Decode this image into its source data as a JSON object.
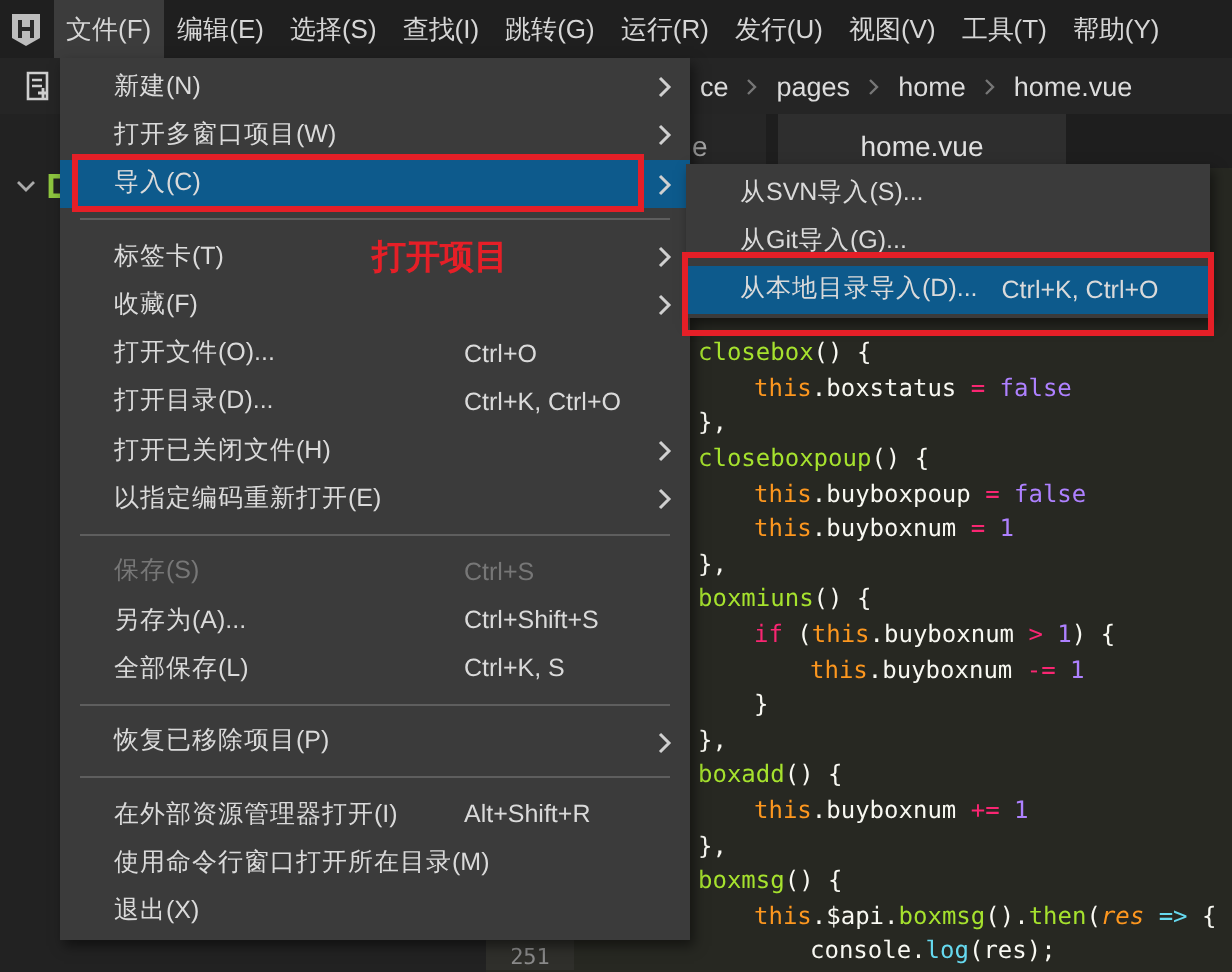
{
  "menubar": [
    {
      "label": "文件(F)",
      "selected": true
    },
    {
      "label": "编辑(E)",
      "selected": false
    },
    {
      "label": "选择(S)",
      "selected": false
    },
    {
      "label": "查找(I)",
      "selected": false
    },
    {
      "label": "跳转(G)",
      "selected": false
    },
    {
      "label": "运行(R)",
      "selected": false
    },
    {
      "label": "发行(U)",
      "selected": false
    },
    {
      "label": "视图(V)",
      "selected": false
    },
    {
      "label": "工具(T)",
      "selected": false
    },
    {
      "label": "帮助(Y)",
      "selected": false
    }
  ],
  "breadcrumb": [
    "ce",
    "pages",
    "home",
    "home.vue"
  ],
  "tabs": [
    {
      "label": "e",
      "selected": false
    },
    {
      "label": "home.vue",
      "selected": true
    }
  ],
  "code_lines": [
    {
      "tokens": [
        {
          "kind": "fn",
          "text": "closebox"
        },
        {
          "kind": "punct",
          "text": "() {"
        }
      ],
      "children": [
        {
          "tokens": [
            {
              "kind": "this",
              "text": "this"
            },
            {
              "kind": "punct",
              "text": ".boxstatus"
            },
            {
              "kind": "op",
              "text": "="
            },
            {
              "kind": "literal",
              "text": "false"
            }
          ]
        }
      ]
    },
    {
      "tokens": [
        {
          "kind": "punct",
          "text": "},"
        }
      ]
    },
    {
      "tokens": [
        {
          "kind": "fn",
          "text": "closeboxpoup"
        },
        {
          "kind": "punct",
          "text": "() {"
        }
      ],
      "children": [
        {
          "tokens": [
            {
              "kind": "this",
              "text": "this"
            },
            {
              "kind": "punct",
              "text": ".buyboxpoup"
            },
            {
              "kind": "op",
              "text": "="
            },
            {
              "kind": "literal",
              "text": "false"
            }
          ]
        },
        {
          "tokens": [
            {
              "kind": "this",
              "text": "this"
            },
            {
              "kind": "punct",
              "text": ".buyboxnum"
            },
            {
              "kind": "op",
              "text": "="
            },
            {
              "kind": "literal",
              "text": "1"
            }
          ]
        }
      ]
    },
    {
      "tokens": [
        {
          "kind": "punct",
          "text": "},"
        }
      ]
    },
    {
      "tokens": [
        {
          "kind": "fn",
          "text": "boxmiuns"
        },
        {
          "kind": "punct",
          "text": "() {"
        }
      ],
      "children": [
        {
          "tokens": [
            {
              "kind": "keyword",
              "text": "if"
            },
            {
              "kind": "punct",
              "text": "("
            },
            {
              "kind": "this",
              "text": "this"
            },
            {
              "kind": "punct",
              "text": ".buyboxnum"
            },
            {
              "kind": "op",
              "text": ">"
            },
            {
              "kind": "literal",
              "text": "1"
            },
            {
              "kind": "punct",
              "text": ") {"
            }
          ],
          "children": [
            {
              "tokens": [
                {
                  "kind": "this",
                  "text": "this"
                },
                {
                  "kind": "punct",
                  "text": ".buyboxnum"
                },
                {
                  "kind": "op",
                  "text": "-="
                },
                {
                  "kind": "literal",
                  "text": "1"
                }
              ]
            }
          ]
        },
        {
          "tokens": [
            {
              "kind": "punct",
              "text": "}"
            }
          ]
        }
      ]
    },
    {
      "tokens": [
        {
          "kind": "punct",
          "text": "},"
        }
      ]
    },
    {
      "tokens": [
        {
          "kind": "fn",
          "text": "boxadd"
        },
        {
          "kind": "punct",
          "text": "() {"
        }
      ],
      "children": [
        {
          "tokens": [
            {
              "kind": "this",
              "text": "this"
            },
            {
              "kind": "punct",
              "text": ".buyboxnum"
            },
            {
              "kind": "op",
              "text": "+="
            },
            {
              "kind": "literal",
              "text": "1"
            }
          ]
        }
      ]
    },
    {
      "tokens": [
        {
          "kind": "punct",
          "text": "},"
        }
      ]
    },
    {
      "tokens": [
        {
          "kind": "fn",
          "text": "boxmsg"
        },
        {
          "kind": "punct",
          "text": "() {"
        }
      ],
      "children": [
        {
          "tokens": [
            {
              "kind": "this",
              "text": "this"
            },
            {
              "kind": "punct",
              "text": ".$api."
            },
            {
              "kind": "fn",
              "text": "boxmsg"
            },
            {
              "kind": "punct",
              "text": "()."
            },
            {
              "kind": "fn",
              "text": "then"
            },
            {
              "kind": "punct",
              "text": "("
            },
            {
              "kind": "param",
              "text": "res"
            },
            {
              "kind": "arrow",
              "text": "=>"
            },
            {
              "kind": "punct",
              "text": "{"
            }
          ],
          "children": [
            {
              "line_number": "251",
              "tokens": [
                {
                  "kind": "punct",
                  "text": "console."
                },
                {
                  "kind": "builtin",
                  "text": "log"
                },
                {
                  "kind": "punct",
                  "text": "(res);"
                }
              ]
            }
          ]
        }
      ]
    }
  ],
  "file_menu": [
    {
      "kind": "item",
      "label": "新建(N)",
      "submenu": true,
      "selected": false,
      "disabled": false
    },
    {
      "kind": "item",
      "label": "打开多窗口项目(W)",
      "submenu": true,
      "selected": false,
      "disabled": false
    },
    {
      "kind": "item",
      "label": "导入(C)",
      "submenu": true,
      "selected": true,
      "disabled": false
    },
    {
      "kind": "separator"
    },
    {
      "kind": "item",
      "label": "标签卡(T)",
      "submenu": true,
      "selected": false,
      "disabled": false
    },
    {
      "kind": "item",
      "label": "收藏(F)",
      "submenu": true,
      "selected": false,
      "disabled": false
    },
    {
      "kind": "item",
      "label": "打开文件(O)...",
      "shortcut": "Ctrl+O",
      "submenu": false,
      "selected": false,
      "disabled": false
    },
    {
      "kind": "item",
      "label": "打开目录(D)...",
      "shortcut": "Ctrl+K, Ctrl+O",
      "submenu": false,
      "selected": false,
      "disabled": false
    },
    {
      "kind": "item",
      "label": "打开已关闭文件(H)",
      "submenu": true,
      "selected": false,
      "disabled": false
    },
    {
      "kind": "item",
      "label": "以指定编码重新打开(E)",
      "submenu": true,
      "selected": false,
      "disabled": false
    },
    {
      "kind": "separator"
    },
    {
      "kind": "item",
      "label": "保存(S)",
      "shortcut": "Ctrl+S",
      "submenu": false,
      "selected": false,
      "disabled": true
    },
    {
      "kind": "item",
      "label": "另存为(A)...",
      "shortcut": "Ctrl+Shift+S",
      "submenu": false,
      "selected": false,
      "disabled": false
    },
    {
      "kind": "item",
      "label": "全部保存(L)",
      "shortcut": "Ctrl+K, S",
      "submenu": false,
      "selected": false,
      "disabled": false
    },
    {
      "kind": "separator"
    },
    {
      "kind": "item",
      "label": "恢复已移除项目(P)",
      "submenu": true,
      "selected": false,
      "disabled": false
    },
    {
      "kind": "separator"
    },
    {
      "kind": "item",
      "label": "在外部资源管理器打开(I)",
      "shortcut": "Alt+Shift+R",
      "submenu": false,
      "selected": false,
      "disabled": false
    },
    {
      "kind": "item",
      "label": "使用命令行窗口打开所在目录(M)",
      "submenu": false,
      "selected": false,
      "disabled": false
    },
    {
      "kind": "item",
      "label": "退出(X)",
      "submenu": false,
      "selected": false,
      "disabled": false
    }
  ],
  "import_submenu": [
    {
      "label": "从SVN导入(S)...",
      "selected": false
    },
    {
      "label": "从Git导入(G)...",
      "selected": false
    },
    {
      "label": "从本地目录导入(D)...",
      "shortcut": "Ctrl+K, Ctrl+O",
      "selected": true
    }
  ],
  "annotation": {
    "text": "打开项目"
  }
}
